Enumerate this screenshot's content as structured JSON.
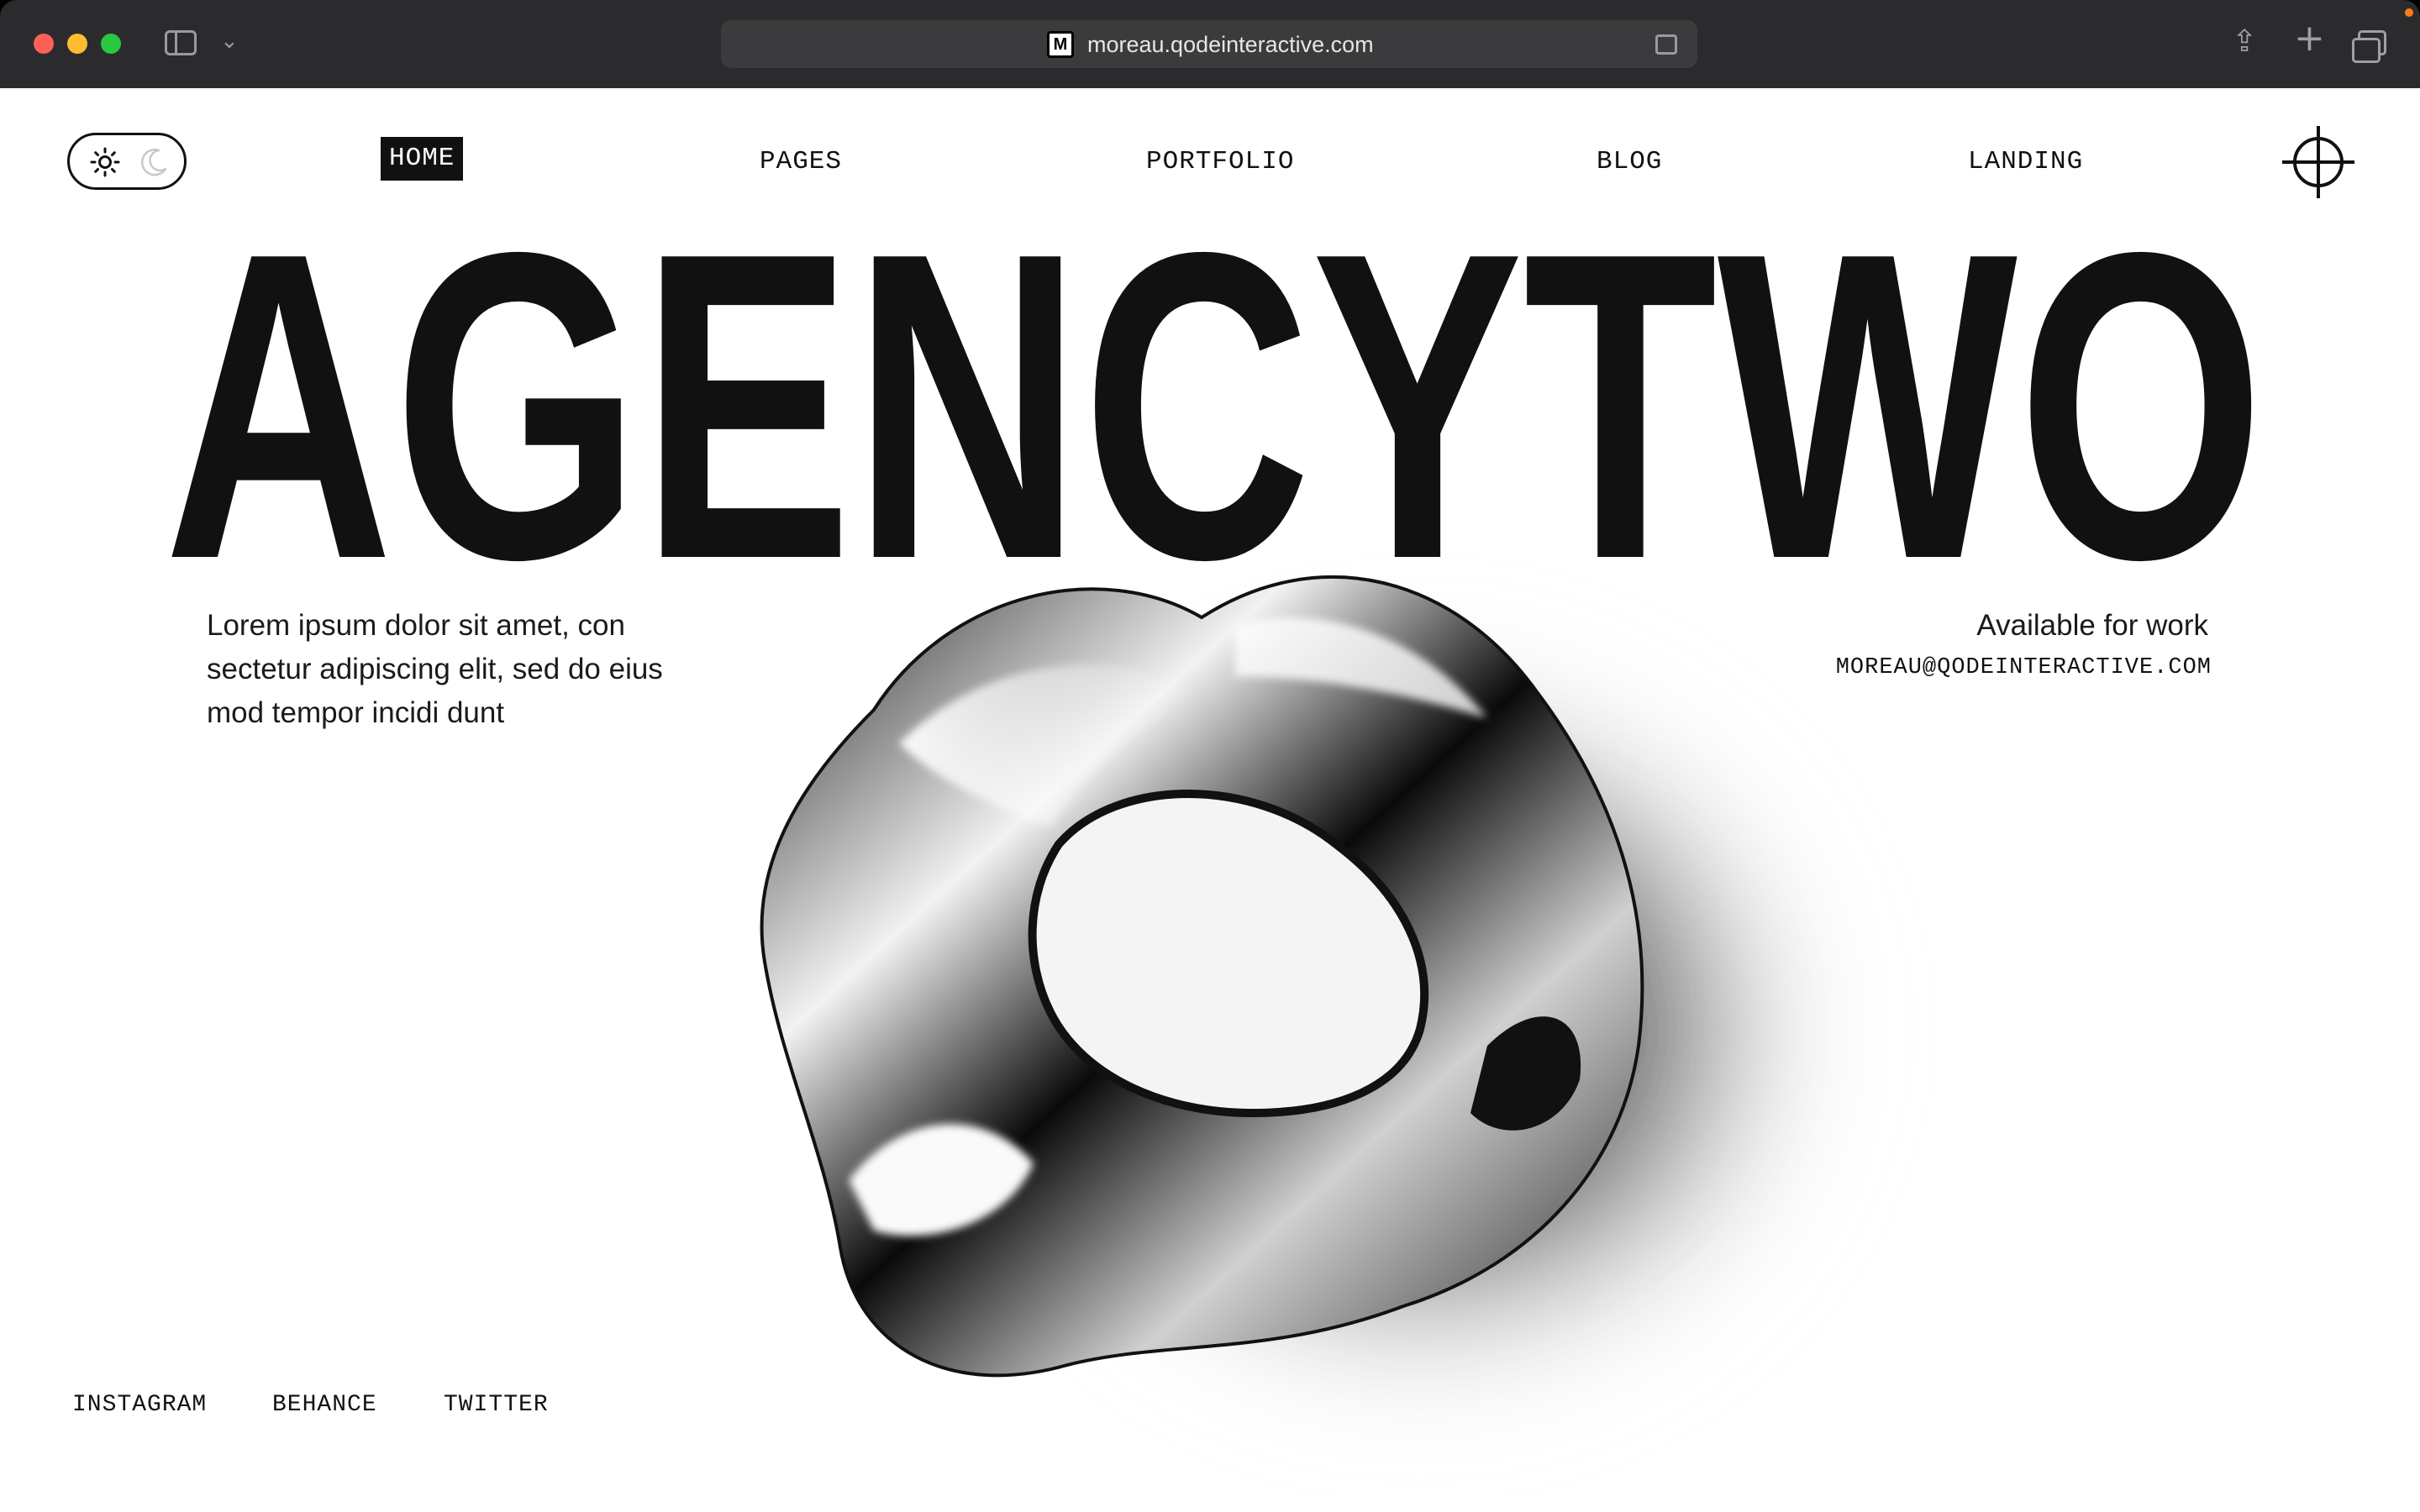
{
  "browser": {
    "url": "moreau.qodeinteractive.com",
    "favicon_letter": "M",
    "icons": {
      "sidebar": "sidebar-icon",
      "chevron": "chevron-down-icon",
      "reader": "reader-icon",
      "share": "share-icon",
      "new_tab": "plus-icon",
      "tabs": "tabs-overview-icon"
    }
  },
  "header": {
    "theme_toggle": {
      "light_icon": "sun-icon",
      "dark_icon": "moon-icon",
      "active": "light"
    },
    "nav": [
      {
        "label": "HOME",
        "active": true
      },
      {
        "label": "PAGES",
        "active": false
      },
      {
        "label": "PORTFOLIO",
        "active": false
      },
      {
        "label": "BLOG",
        "active": false
      },
      {
        "label": "LANDING",
        "active": false
      }
    ],
    "menu_icon": "crosshair-icon"
  },
  "hero": {
    "title": "AGENCYTWO",
    "intro": "Lorem ipsum dolor sit amet, con sectetur adipiscing elit, sed do eius mod tempor incidi dunt",
    "availability": "Available for work",
    "email": "MOREAU@QODEINTERACTIVE.COM"
  },
  "footer": {
    "social": [
      "INSTAGRAM",
      "BEHANCE",
      "TWITTER"
    ]
  },
  "colors": {
    "text": "#111111",
    "background": "#ffffff",
    "chrome": "#2b2b2d",
    "urlbar": "#3b3b3e"
  }
}
